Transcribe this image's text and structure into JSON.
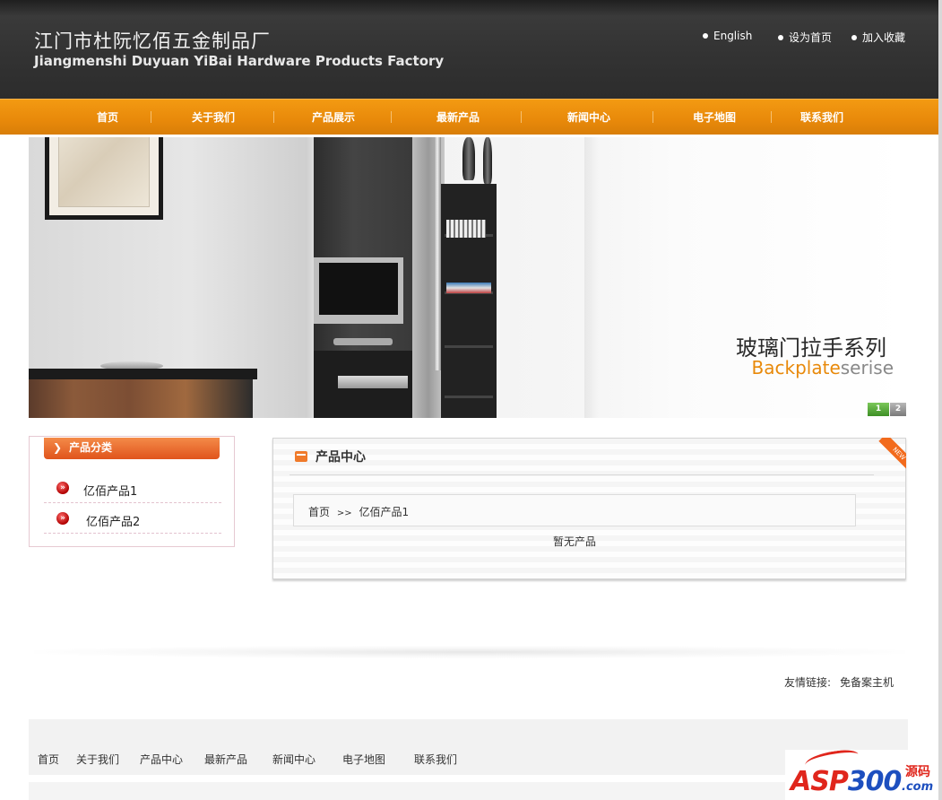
{
  "header": {
    "company_cn": "江门市杜阮忆佰五金制品厂",
    "company_en": "Jiangmenshi Duyuan YiBai Hardware Products Factory",
    "links": [
      "English",
      "设为首页",
      "加入收藏"
    ]
  },
  "nav": {
    "items": [
      "首页",
      "关于我们",
      "产品展示",
      "最新产品",
      "新闻中心",
      "电子地图",
      "联系我们"
    ]
  },
  "banner": {
    "title_cn": "玻璃门拉手系列",
    "title_en_accent": "Backplate",
    "title_en_rest": "serise",
    "pager": [
      "1",
      "2"
    ]
  },
  "sidebar": {
    "title": "产品分类",
    "items": [
      "亿佰产品1",
      "亿佰产品2"
    ]
  },
  "main": {
    "title": "产品中心",
    "ribbon": "NEW",
    "breadcrumb_home": "首页",
    "breadcrumb_sep": ">>",
    "breadcrumb_current": "亿佰产品1",
    "empty_message": "暂无产品"
  },
  "friend_links": {
    "label": "友情链接:",
    "items": [
      "免备案主机"
    ]
  },
  "footer": {
    "links": [
      "首页",
      "关于我们",
      "产品中心",
      "最新产品",
      "新闻中心",
      "电子地图",
      "联系我们"
    ]
  },
  "watermark": {
    "brand_a": "ASP",
    "brand_b": "300",
    "side": "源码",
    "suffix": ".com"
  },
  "colors": {
    "nav_orange": "#e8890a",
    "header_dark": "#333333",
    "accent_red": "#b00000"
  }
}
